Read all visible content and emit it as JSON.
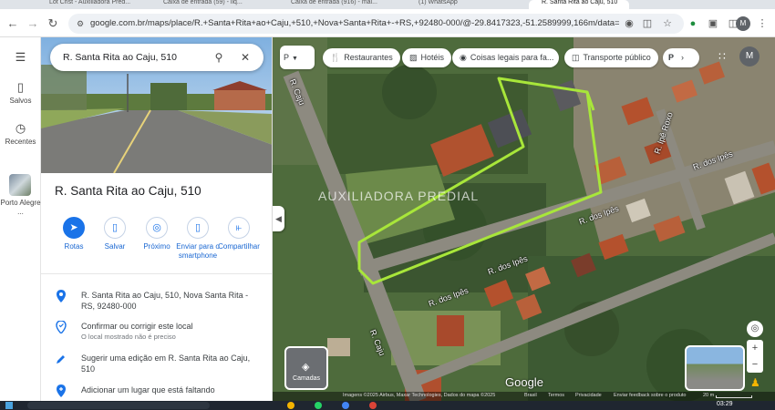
{
  "browser": {
    "tabs": [
      {
        "label": "Lot Crist - Auxiliadora Pred..."
      },
      {
        "label": "Caixa de entrada (59) - liq..."
      },
      {
        "label": "Caixa de entrada (916) - mai..."
      },
      {
        "label": "(1) WhatsApp"
      },
      {
        "label": "R. Santa Rita ao Caju, 510"
      }
    ],
    "url": "google.com.br/maps/place/R.+Santa+Rita+ao+Caju,+510,+Nova+Santa+Rita+-+RS,+92480-000/@-29.8417323,-51.2589999,166m/data=!3m1!1e3!...",
    "profile_initial": "M"
  },
  "rail": {
    "menu_icon": "menu-icon",
    "saved_label": "Salvos",
    "recent_label": "Recentes",
    "recent_place_label": "Porto Alegre ..."
  },
  "panel": {
    "search_value": "R. Santa Rita ao Caju, 510",
    "title": "R. Santa Rita ao Caju, 510",
    "actions": [
      {
        "label": "Rotas",
        "icon": "directions-icon"
      },
      {
        "label": "Salvar",
        "icon": "bookmark-icon"
      },
      {
        "label": "Próximo",
        "icon": "nearby-icon"
      },
      {
        "label": "Enviar para o smartphone",
        "icon": "send-to-phone-icon"
      },
      {
        "label": "Compartilhar",
        "icon": "share-icon"
      }
    ],
    "address": "R. Santa Rita ao Caju, 510, Nova Santa Rita - RS, 92480-000",
    "confirm_label": "Confirmar ou corrigir este local",
    "confirm_sub": "O local mostrado não é preciso",
    "suggest_label": "Sugerir uma edição em R. Santa Rita ao Caju, 510",
    "add_place_label": "Adicionar um lugar que está faltando"
  },
  "map": {
    "chips": [
      {
        "label": "Restaurantes",
        "icon": "fork-knife-icon"
      },
      {
        "label": "Hotéis",
        "icon": "bed-icon"
      },
      {
        "label": "Coisas legais para fa...",
        "icon": "camera-icon"
      },
      {
        "label": "Transporte público",
        "icon": "transit-icon"
      }
    ],
    "parking_label": "P",
    "street_labels": [
      "R. Caju",
      "R. Caju",
      "R. dos Ipês",
      "R. dos Ipês",
      "R. dos Ipês",
      "R. dos Ipês",
      "R. Ipê Roxo"
    ],
    "watermark": "AUXILIADORA PREDIAL",
    "layers_label": "Camadas",
    "google_label": "Google",
    "attribution": "Imagens ©2025 Airbus, Maxar Technologies, Dados do mapa ©2025",
    "footer_links": [
      "Brasil",
      "Termos",
      "Privacidade",
      "Enviar feedback sobre o produto"
    ],
    "scale_label": "20 m"
  },
  "taskbar": {
    "time": "03:29"
  }
}
